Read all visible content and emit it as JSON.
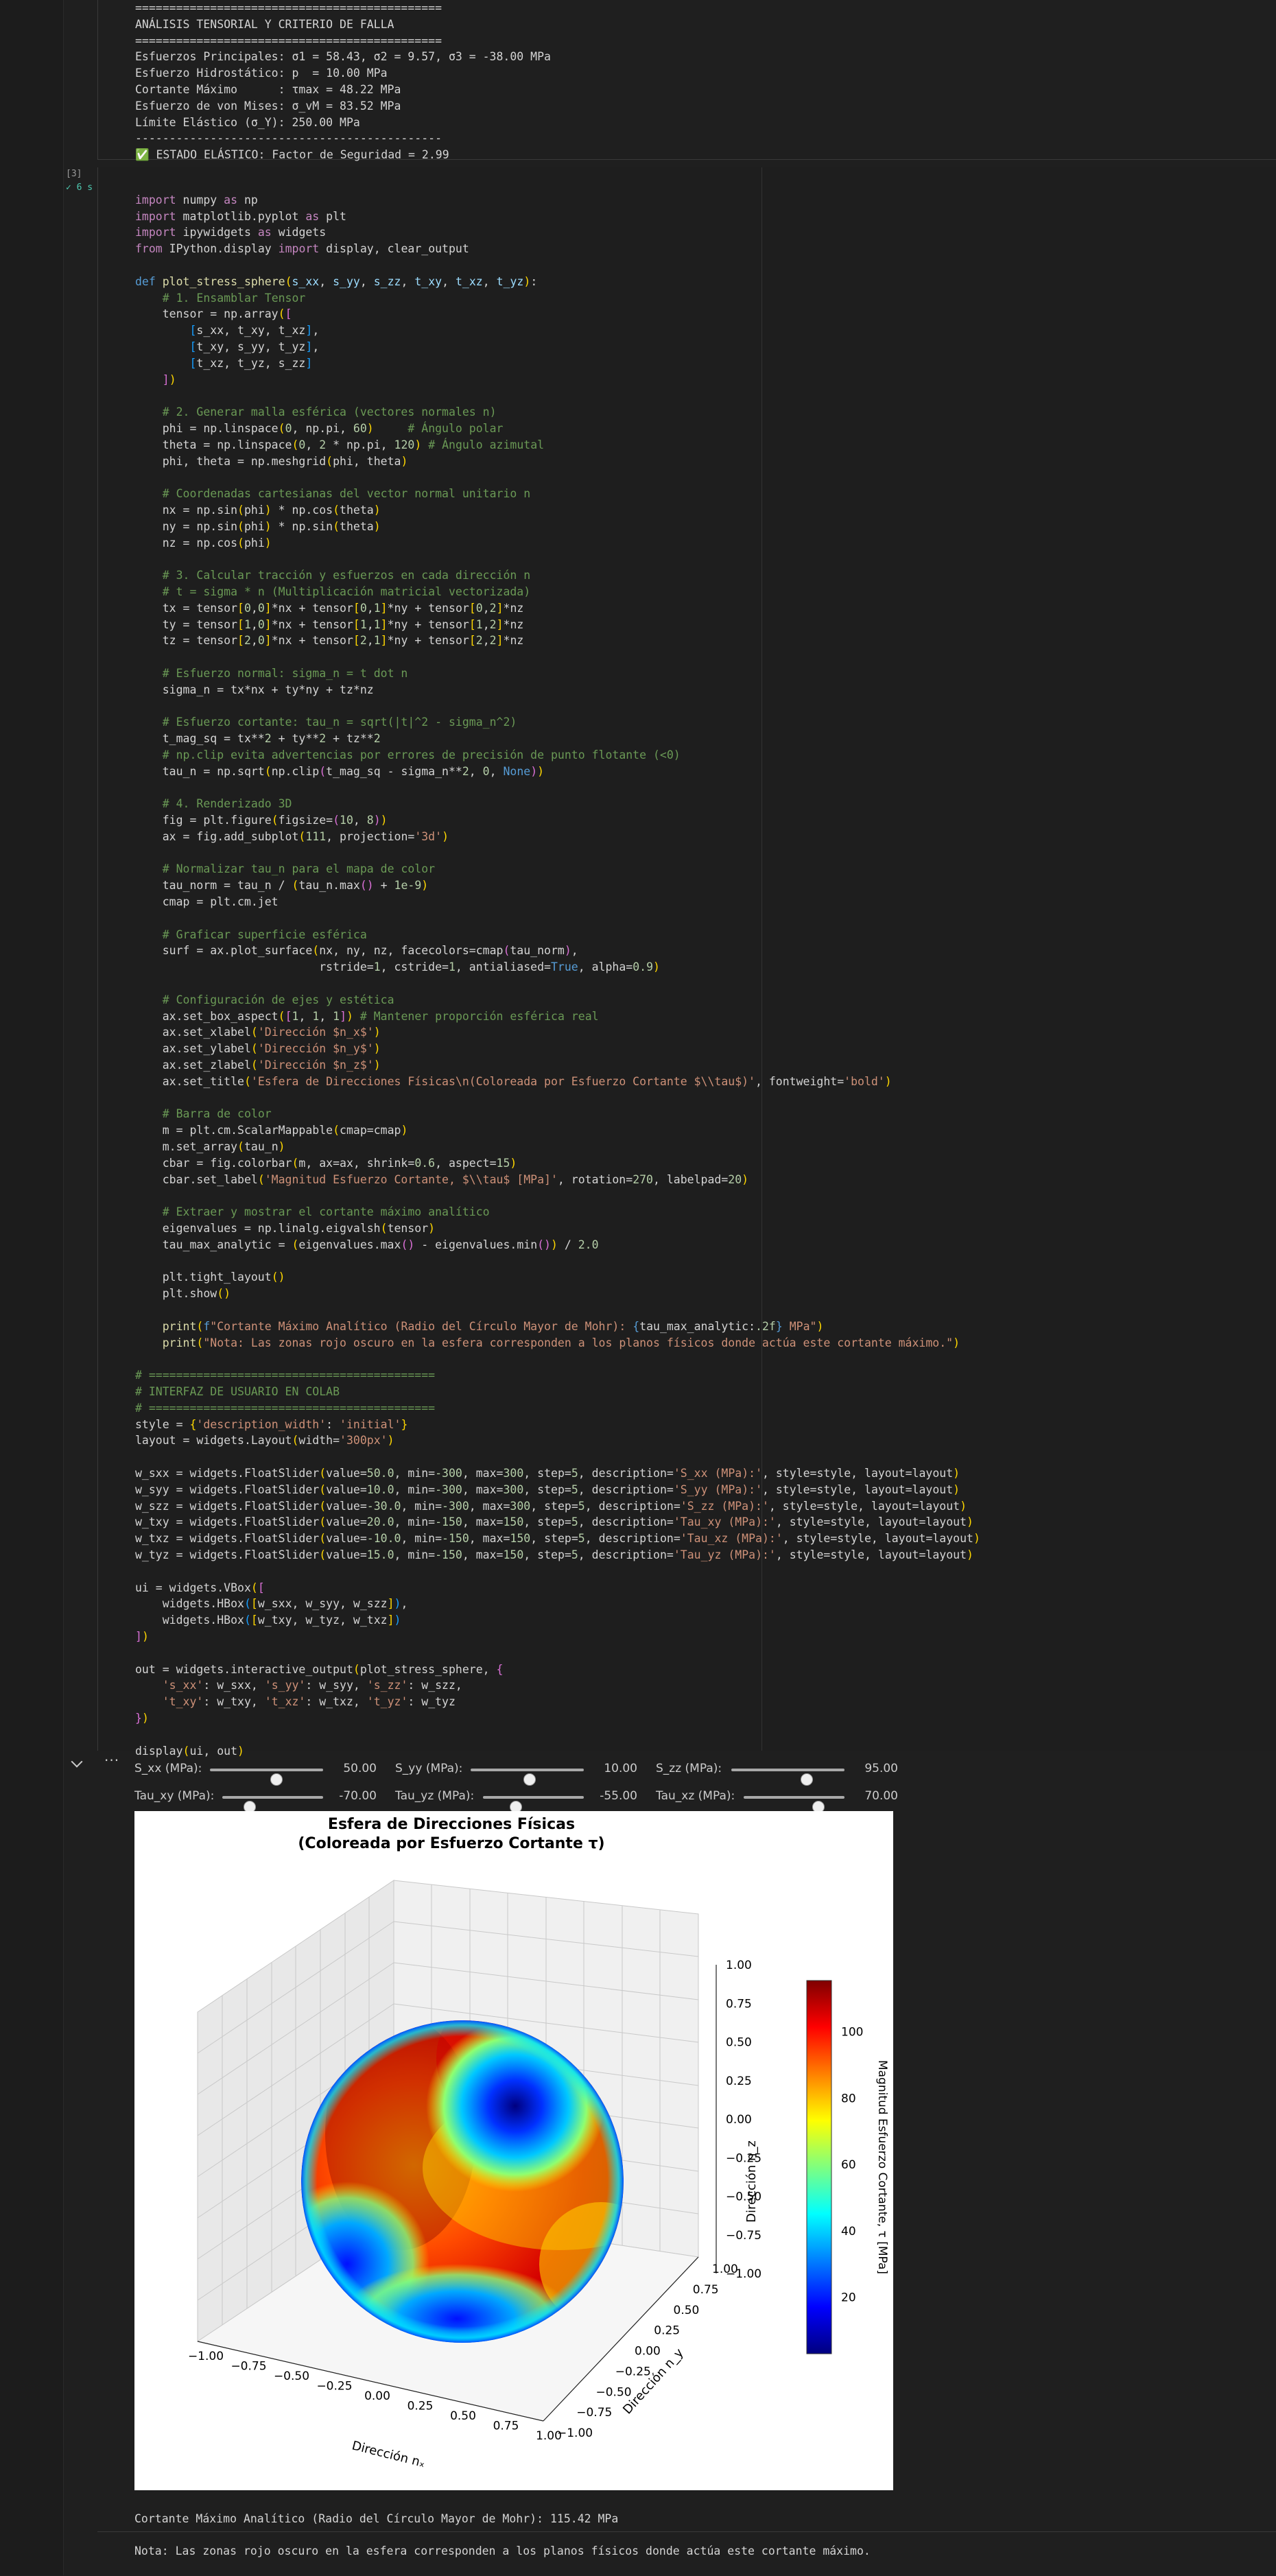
{
  "cell_prev_output": {
    "lines": [
      "=============================================",
      "ANÁLISIS TENSORIAL Y CRITERIO DE FALLA",
      "=============================================",
      "Esfuerzos Principales: σ1 = 58.43, σ2 = 9.57, σ3 = -38.00 MPa",
      "Esfuerzo Hidrostático: p  = 10.00 MPa",
      "Cortante Máximo      : τmax = 48.22 MPa",
      "Esfuerzo de von Mises: σ_vM = 83.52 MPa",
      "Límite Elástico (σ_Y): 250.00 MPa",
      "---------------------------------------------",
      "✅ ESTADO ELÁSTICO: Factor de Seguridad = 2.99"
    ]
  },
  "code_cell": {
    "exec_count": "[3]",
    "exec_time": "✓ 6 s"
  },
  "widgets": {
    "sliders": [
      {
        "label": "S_xx (MPa):",
        "value": "50.00",
        "fraction": 0.583
      },
      {
        "label": "S_yy (MPa):",
        "value": "10.00",
        "fraction": 0.517
      },
      {
        "label": "S_zz (MPa):",
        "value": "95.00",
        "fraction": 0.658
      },
      {
        "label": "Tau_xy (MPa):",
        "value": "-70.00",
        "fraction": 0.267
      },
      {
        "label": "Tau_yz (MPa):",
        "value": "-55.00",
        "fraction": 0.317
      },
      {
        "label": "Tau_xz (MPa):",
        "value": "70.00",
        "fraction": 0.733
      }
    ]
  },
  "figure": {
    "title_line1": "Esfera de Direcciones Físicas",
    "title_line2": "(Coloreada por Esfuerzo Cortante τ)",
    "xlabel": "Dirección nₓ",
    "ylabel": "Dirección n_y",
    "zlabel": "Dirección n_z",
    "x_ticks": [
      "−1.00",
      "−0.75",
      "−0.50",
      "−0.25",
      "0.00",
      "0.25",
      "0.50",
      "0.75",
      "1.00"
    ],
    "y_ticks": [
      "−1.00",
      "−0.75",
      "−0.50",
      "−0.25",
      "0.00",
      "0.25",
      "0.50",
      "0.75",
      "1.00"
    ],
    "z_ticks": [
      "1.00",
      "0.75",
      "0.50",
      "0.25",
      "0.00",
      "−0.25",
      "−0.50",
      "−0.75",
      "−1.00"
    ],
    "colorbar_label": "Magnitud Esfuerzo Cortante, τ [MPa]",
    "colorbar_ticks": [
      "100",
      "80",
      "60",
      "40",
      "20"
    ]
  },
  "chart_data": {
    "type": "heatmap",
    "title": "Esfera de Direcciones Físicas (Coloreada por Esfuerzo Cortante τ)",
    "xlabel": "Dirección nₓ",
    "ylabel": "Dirección n_y",
    "zlabel": "Dirección n_z",
    "xlim": [
      -1,
      1
    ],
    "ylim": [
      -1,
      1
    ],
    "zlim": [
      -1,
      1
    ],
    "colorbar": {
      "label": "Magnitud Esfuerzo Cortante, τ [MPa]",
      "min": 3,
      "max": 115.42,
      "ticks": [
        20,
        40,
        60,
        80,
        100
      ],
      "colormap": "jet"
    },
    "grid": true
  },
  "plot_output": {
    "line1": "Cortante Máximo Analítico (Radio del Círculo Mayor de Mohr): 115.42 MPa",
    "line2": "Nota: Las zonas rojo oscuro en la esfera corresponden a los planos físicos donde actúa este cortante máximo."
  }
}
